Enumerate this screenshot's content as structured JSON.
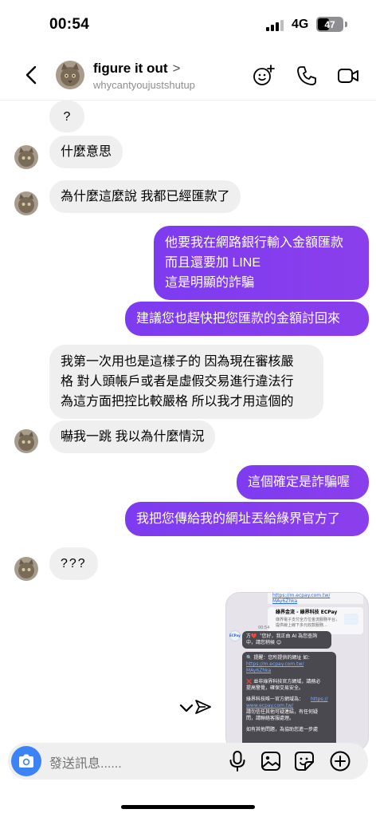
{
  "status": {
    "time": "00:54",
    "network": "4G",
    "battery": "47",
    "battery_level": 0.47
  },
  "header": {
    "name": "figure it out",
    "chevron": ">",
    "username": "whycantyoujustshutup"
  },
  "messages": {
    "m1": "?",
    "m2": "什麼意思",
    "m3": "為什麼這麼說 我都已經匯款了",
    "m4_l1": "他要我在網路銀行輸入金額匯款",
    "m4_l2": "而且還要加 LINE",
    "m4_l3": "這是明顯的詐騙",
    "m5": "建議您也趕快把您匯款的金額討回來",
    "m6_l1": "我第一次用也是這樣子的 因為現在審核嚴",
    "m6_l2": "格 對人頭帳戶或者是虛假交易進行違法行",
    "m6_l3": "為這方面把控比較嚴格 所以我才用這個的",
    "m7": "嚇我一跳 我以為什麼情況",
    "m8": "這個確定是詐騙喔",
    "m9": "我把您傳給我的網址丟給綠界官方了",
    "m10": "???"
  },
  "shared_image": {
    "url_top_1": "https://m.ecpay.com.tw/",
    "url_top_2": "MAy6Zhka",
    "card_title": "綠界金流 - 綠界科技 ECPay",
    "card_sub_1": "綠界電子支付全方位金流服務平台，",
    "card_sub_2": "提供線上線下多元收款服務…",
    "time": "00:54",
    "brand": "ECPay",
    "q1_l1": "方❤️〝您好，我正由 AI 為您查詢",
    "q1_l2": "中，請您稍候 😊",
    "q2_l1": "🔍 提醒：您所提供的網址 如：",
    "q2_l2": "https://m.ecpay.com.tw/",
    "q2_l3": "MAy6Zhka",
    "q2_l4": "❌ 並非綠界科技官方網域，請務必",
    "q2_l5": "提高警覺，確保交易安全。",
    "q2_l6": "綠界科技唯一官方網域為：",
    "q2_l7": "https://",
    "q2_l8": "www.ecpay.com.tw/",
    "q2_l9": "請勿信任其他可疑連結，有任何疑",
    "q2_l10": "問，請聯絡客服處理。",
    "q2_l11": "如有其他問題，為協助您進一步處"
  },
  "composer": {
    "placeholder": "發送訊息......"
  },
  "icons": [
    "back-chevron-icon",
    "add-effects-icon",
    "phone-icon",
    "video-icon",
    "camera-icon",
    "microphone-icon",
    "gallery-icon",
    "sticker-icon",
    "plus-circle-icon",
    "chevron-down-icon",
    "send-icon"
  ],
  "colors": {
    "outgoing_bubble": "#8b3fec",
    "incoming_bubble": "#efefef",
    "camera_button": "#3c83f6",
    "link": "#2d6bd6"
  }
}
